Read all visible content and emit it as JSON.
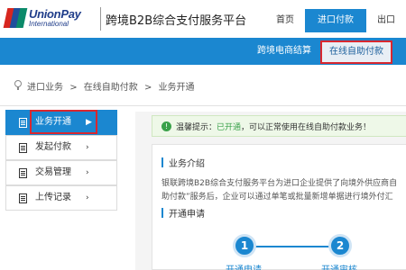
{
  "header": {
    "logo_text": "UnionPay",
    "logo_sub": "International",
    "logo_badge": "银联",
    "title": "跨境B2B综合支付服务平台",
    "nav": [
      {
        "label": "首页"
      },
      {
        "label": "进口付款"
      },
      {
        "label": "出口"
      }
    ]
  },
  "subnav": {
    "items": [
      {
        "label": "跨境电商结算"
      },
      {
        "label": "在线自助付款"
      }
    ]
  },
  "breadcrumb": {
    "items": [
      "进口业务",
      ">",
      "在线自助付款",
      ">",
      "业务开通"
    ]
  },
  "sidebar": {
    "items": [
      {
        "label": "业务开通",
        "chevron": "▶"
      },
      {
        "label": "发起付款",
        "chevron": "›"
      },
      {
        "label": "交易管理",
        "chevron": "›"
      },
      {
        "label": "上传记录",
        "chevron": "›"
      }
    ]
  },
  "notice": {
    "prefix": "温馨提示：",
    "status": "已开通",
    "suffix": "，可以正常使用在线自助付款业务！"
  },
  "content": {
    "intro_title": "业务介绍",
    "intro_line1": "银联跨境B2B综合支付服务平台为进口企业提供了向境外供应商自",
    "intro_line2": "助付款”服务后，企业可以通过单笔或批量新增单据进行境外付汇",
    "open_title": "开通申请",
    "steps": [
      {
        "num": "1",
        "label": "开通申请"
      },
      {
        "num": "2",
        "label": "开通审核"
      }
    ]
  },
  "colors": {
    "primary": "#1b87d0",
    "highlight_border": "#d9272f",
    "success": "#3aa14a"
  }
}
